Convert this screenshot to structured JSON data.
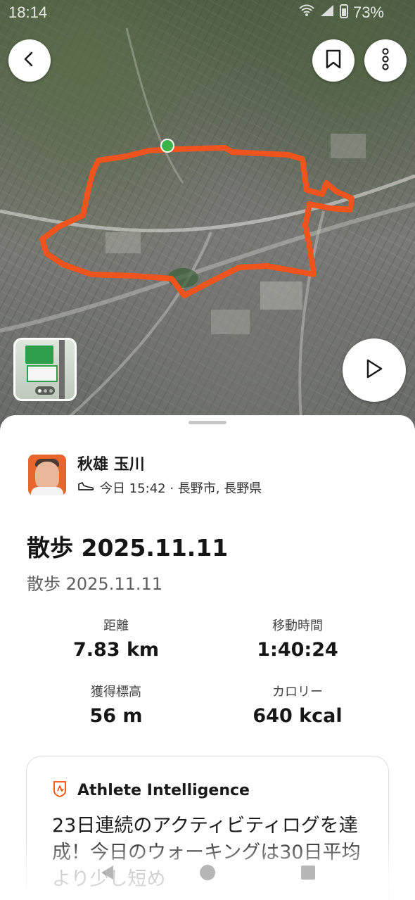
{
  "status_bar": {
    "time": "18:14",
    "battery": "73%"
  },
  "map": {
    "route_color": "#f0541e",
    "start_marker_color": "#3bb54a",
    "photo_count_dots": 3
  },
  "top_actions": {
    "back_icon": "chevron-left-icon",
    "bookmark_icon": "bookmark-icon",
    "more_icon": "vertical-dots-icon",
    "play_icon": "play-icon"
  },
  "athlete": {
    "name": "秋雄 玉川",
    "activity_icon": "shoe-icon",
    "meta": "今日 15:42 · 長野市, 長野県"
  },
  "activity": {
    "title": "散歩 2025.11.11",
    "subtitle": "散歩 2025.11.11"
  },
  "stats": [
    {
      "label": "距離",
      "value": "7.83 km"
    },
    {
      "label": "移動時間",
      "value": "1:40:24"
    },
    {
      "label": "獲得標高",
      "value": "56 m"
    },
    {
      "label": "カロリー",
      "value": "640 kcal"
    }
  ],
  "athlete_intelligence": {
    "title": "Athlete Intelligence",
    "text": "23日連続のアクティビティログを達成！今日のウォーキングは30日平均より少し短め"
  },
  "colors": {
    "accent": "#fc4c02",
    "route": "#f0541e"
  }
}
